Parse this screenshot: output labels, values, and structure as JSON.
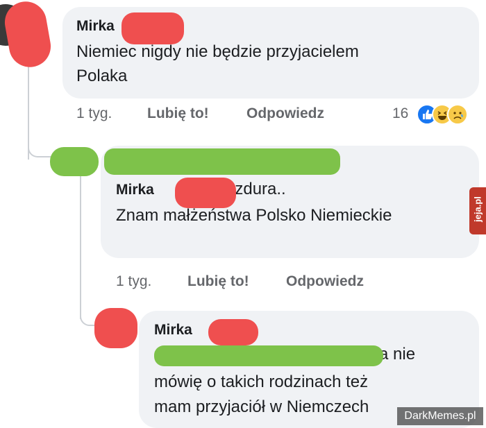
{
  "comments": [
    {
      "author": "Mirka",
      "text_lines": [
        "Niemiec nigdy nie będzie przyjacielem",
        "Polaka"
      ],
      "time": "1 tyg.",
      "like": "Lubię to!",
      "reply": "Odpowiedz",
      "reaction_count": "16"
    },
    {
      "author": "Mirka",
      "text_inline": "bzdura..",
      "text_line2": "Znam małżeństwa Polsko Niemieckie",
      "time": "1 tyg.",
      "like": "Lubię to!",
      "reply": "Odpowiedz"
    },
    {
      "author": "Mirka",
      "text_tail": "a nie",
      "text_lines": [
        "mówię o takich rodzinach też",
        "mam przyjaciół w Niemczech"
      ]
    }
  ],
  "watermarks": {
    "side": "jeja.pl",
    "corner": "DarkMemes.pl"
  },
  "reactions": [
    "like-icon",
    "haha-icon",
    "sad-icon"
  ],
  "colors": {
    "bubble": "#f0f2f5",
    "meta_text": "#65676b",
    "red_redaction": "#ef4f4f",
    "green_redaction": "#7ec24a",
    "like_blue": "#1877f2",
    "emoji_yellow": "#f7c948"
  }
}
